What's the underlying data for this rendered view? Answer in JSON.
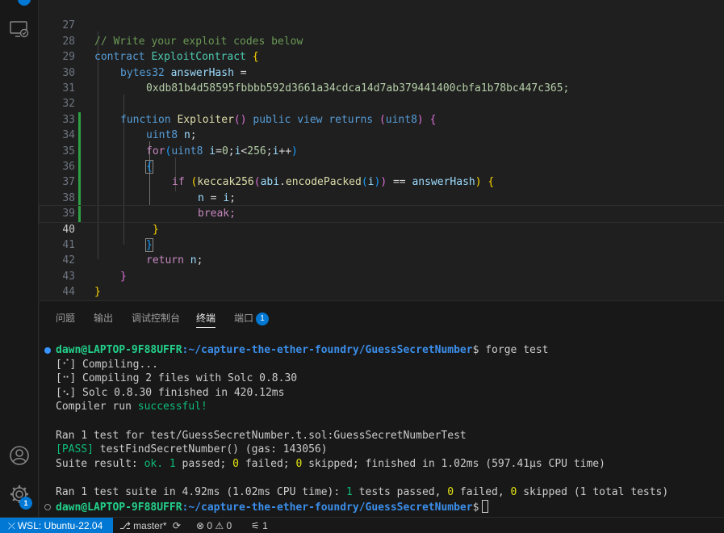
{
  "activity_bar": {
    "icons": [
      "remote-explorer-icon",
      "account-icon",
      "manage-gear-icon"
    ],
    "manage_badge": "1"
  },
  "editor": {
    "lines": [
      {
        "n": "27",
        "text": "// Write your exploit codes below"
      },
      {
        "n": "28",
        "text": "contract ExploitContract {"
      },
      {
        "n": "29",
        "text": "bytes32 answerHash ="
      },
      {
        "n": "30",
        "text": "0xdb81b4d58595fbbbb592d3661a34cdca14d7ab379441400cbfa1b78bc447c365;"
      },
      {
        "n": "31",
        "text": ""
      },
      {
        "n": "32",
        "text": "function Exploiter() public view returns (uint8) {"
      },
      {
        "n": "33",
        "text": "uint8 n;"
      },
      {
        "n": "34",
        "text": "for(uint8 i=0;i<256;i++)"
      },
      {
        "n": "35",
        "text": "{"
      },
      {
        "n": "36",
        "text": "if (keccak256(abi.encodePacked(i)) == answerHash) {"
      },
      {
        "n": "37",
        "text": "n = i;"
      },
      {
        "n": "38",
        "text": "break;"
      },
      {
        "n": "39",
        "text": "}"
      },
      {
        "n": "40",
        "text": "}"
      },
      {
        "n": "41",
        "text": "return n;"
      },
      {
        "n": "42",
        "text": "}"
      },
      {
        "n": "43",
        "text": "}"
      },
      {
        "n": "44",
        "text": ""
      }
    ]
  },
  "panel": {
    "tabs": [
      "问题",
      "输出",
      "调试控制台",
      "终端",
      "端口"
    ],
    "active_tab": "终端",
    "ports_badge": "1"
  },
  "terminal": {
    "prompt_user": "dawn@LAPTOP-9F88UFFR",
    "prompt_path": ":~/capture-the-ether-foundry/GuessSecretNumber",
    "prompt_symbol": "$",
    "command": " forge test",
    "compiling": "[⠊] Compiling...",
    "compiling_files": "[⠒] Compiling 2 files with Solc 0.8.30",
    "solc_finished": "[⠢] Solc 0.8.30 finished in 420.12ms",
    "compiler_run_prefix": "Compiler run ",
    "compiler_run_status": "successful!",
    "ran_test": "Ran 1 test for test/GuessSecretNumber.t.sol:GuessSecretNumberTest",
    "pass_tag": "[PASS]",
    "pass_text": " testFindSecretNumber() (gas: 143056)",
    "suite_prefix": "Suite result: ",
    "suite_ok": "ok.",
    "suite_passed_num": "1",
    "suite_passed": " passed; ",
    "suite_failed_num": "0",
    "suite_failed": " failed; ",
    "suite_skipped_num": "0",
    "suite_rest": " skipped; finished in 1.02ms (597.41µs CPU time)",
    "summary_prefix": "Ran 1 test suite in 4.92ms (1.02ms CPU time): ",
    "summary_passed_num": "1",
    "summary_passed": " tests passed, ",
    "summary_failed_num": "0",
    "summary_failed": " failed, ",
    "summary_skipped_num": "0",
    "summary_rest": " skipped (1 total tests)"
  },
  "status_bar": {
    "remote": "WSL: Ubuntu-22.04",
    "branch": "master*",
    "errors": "0",
    "warnings": "0",
    "ports": "1"
  },
  "colors": {
    "accent": "#0078d4",
    "modified_gutter": "#2ea043",
    "prompt_green": "#23d18b",
    "prompt_blue": "#3b8eea"
  }
}
